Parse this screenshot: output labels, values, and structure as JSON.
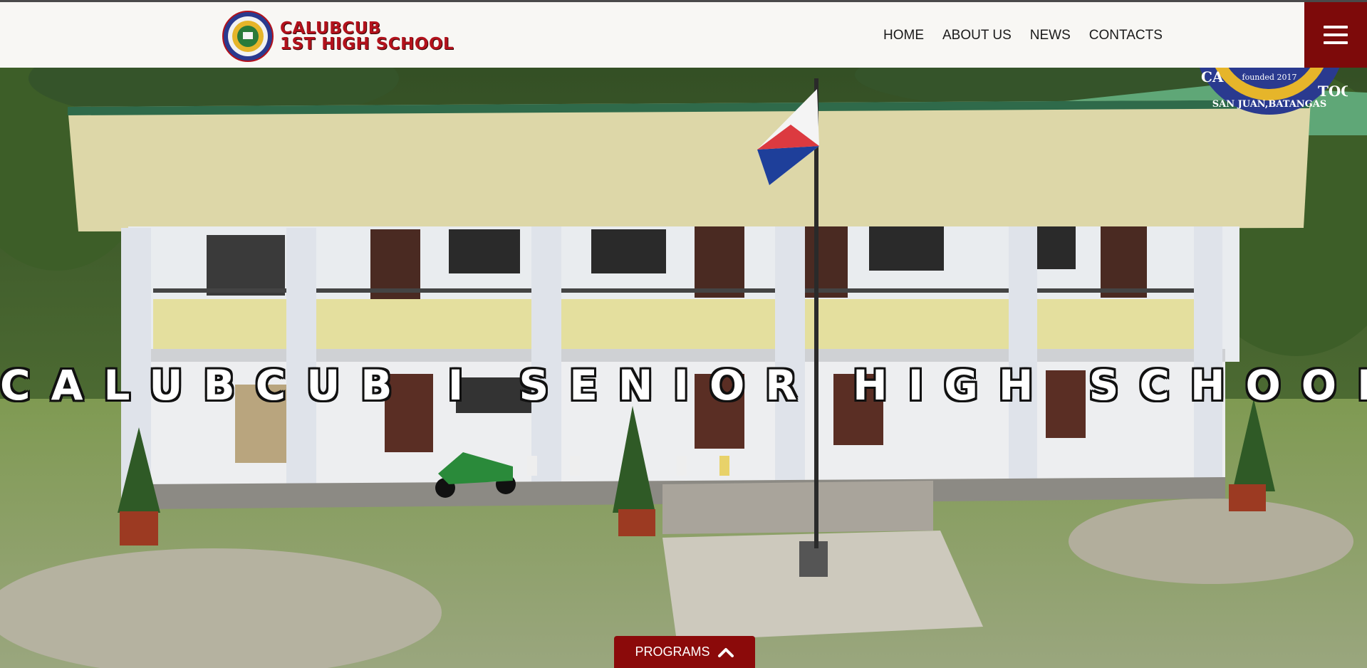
{
  "header": {
    "brand_line1": "CALUBCUB",
    "brand_line2": "1ST HIGH SCHOOL",
    "nav": [
      {
        "label": "HOME"
      },
      {
        "label": "ABOUT US"
      },
      {
        "label": "NEWS"
      },
      {
        "label": "CONTACTS"
      }
    ],
    "menu_icon": "hamburger-menu-icon"
  },
  "seal": {
    "text_founded": "founded 2017",
    "text_location": "SAN JUAN,BATANGAS",
    "text_partial_left": "CA",
    "text_partial_right": "TOO"
  },
  "hero": {
    "title": "CALUBCUB I SENIOR HIGH SCHOOL"
  },
  "programs": {
    "label": "PROGRAMS",
    "icon": "chevron-up-icon"
  },
  "colors": {
    "brand_red": "#b3121c",
    "menu_red": "#7d0a0a",
    "header_bg": "#f8f7f4"
  }
}
